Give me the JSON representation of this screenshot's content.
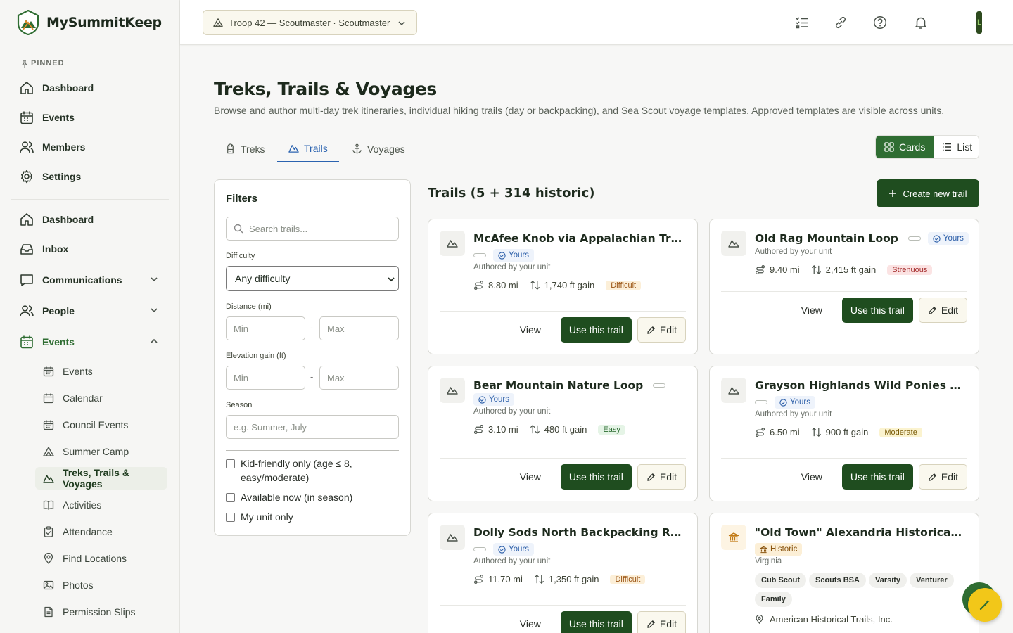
{
  "app": {
    "name": "MySummitKeep"
  },
  "sidebar": {
    "pinned_label": "PINNED",
    "pinned": [
      {
        "label": "Dashboard",
        "icon": "home-icon"
      },
      {
        "label": "Events",
        "icon": "calendar-icon"
      },
      {
        "label": "Members",
        "icon": "users-icon"
      },
      {
        "label": "Settings",
        "icon": "gear-icon"
      }
    ],
    "main": [
      {
        "label": "Dashboard",
        "icon": "home-icon"
      },
      {
        "label": "Inbox",
        "icon": "inbox-icon"
      },
      {
        "label": "Communications",
        "icon": "chat-icon",
        "expanded": false
      },
      {
        "label": "People",
        "icon": "users-icon",
        "expanded": false
      },
      {
        "label": "Events",
        "icon": "calendar-icon",
        "expanded": true
      }
    ],
    "events_sub": [
      {
        "label": "Events",
        "icon": "calendar-icon"
      },
      {
        "label": "Calendar",
        "icon": "calendar-icon"
      },
      {
        "label": "Council Events",
        "icon": "calendar-icon"
      },
      {
        "label": "Summer Camp",
        "icon": "tent-icon"
      },
      {
        "label": "Treks, Trails & Voyages",
        "icon": "mountain-icon",
        "active": true
      },
      {
        "label": "Activities",
        "icon": "book-icon"
      },
      {
        "label": "Attendance",
        "icon": "clipboard-icon"
      },
      {
        "label": "Find Locations",
        "icon": "map-pin-icon"
      },
      {
        "label": "Photos",
        "icon": "photo-icon"
      },
      {
        "label": "Permission Slips",
        "icon": "document-icon"
      }
    ]
  },
  "topbar": {
    "unit_selector": "Troop 42 — Scoutmaster · Scoutmaster",
    "avatar_initial": "L"
  },
  "page": {
    "title": "Treks, Trails & Voyages",
    "description": "Browse and author multi-day trek itineraries, individual hiking trails (day or backpacking), and Sea Scout voyage templates. Approved templates are visible across units.",
    "tabs": [
      {
        "label": "Treks",
        "icon": "backpack-icon"
      },
      {
        "label": "Trails",
        "icon": "mountain-icon",
        "active": true
      },
      {
        "label": "Voyages",
        "icon": "anchor-icon"
      }
    ],
    "view_toggle": {
      "cards": "Cards",
      "list": "List",
      "active": "Cards"
    }
  },
  "filters": {
    "title": "Filters",
    "search_placeholder": "Search trails...",
    "difficulty_label": "Difficulty",
    "difficulty_value": "Any difficulty",
    "distance_label": "Distance (mi)",
    "elevation_label": "Elevation gain (ft)",
    "min_placeholder": "Min",
    "max_placeholder": "Max",
    "range_sep": "-",
    "season_label": "Season",
    "season_placeholder": "e.g. Summer, July",
    "checkboxes": [
      {
        "label": "Kid-friendly only (age ≤ 8, easy/moderate)",
        "checked": false
      },
      {
        "label": "Available now (in season)",
        "checked": false
      },
      {
        "label": "My unit only",
        "checked": false
      }
    ]
  },
  "list": {
    "title": "Trails (5 + 314 historic)",
    "create_label": "Create new trail",
    "view_label": "View",
    "use_label": "Use this trail",
    "edit_label": "Edit",
    "cards": [
      {
        "title": "McAfee Knob via Appalachian Trail",
        "badge": "Yours",
        "author": "Authored by your unit",
        "distance": "8.80 mi",
        "gain": "1,740 ft gain",
        "difficulty": "Difficult",
        "difficulty_color": "#9a5312"
      },
      {
        "title": "Old Rag Mountain Loop",
        "badge": "Yours",
        "author": "Authored by your unit",
        "distance": "9.40 mi",
        "gain": "2,415 ft gain",
        "difficulty": "Strenuous",
        "difficulty_color": "#a32a2a"
      },
      {
        "title": "Bear Mountain Nature Loop",
        "badge": "Yours",
        "author": "Authored by your unit",
        "distance": "3.10 mi",
        "gain": "480 ft gain",
        "difficulty": "Easy",
        "difficulty_color": "#2c6b31"
      },
      {
        "title": "Grayson Highlands Wild Ponies Trek",
        "badge": "Yours",
        "author": "Authored by your unit",
        "distance": "6.50 mi",
        "gain": "900 ft gain",
        "difficulty": "Moderate",
        "difficulty_color": "#7a5b08"
      },
      {
        "title": "Dolly Sods North Backpacking Rou...",
        "badge": "Yours",
        "author": "Authored by your unit",
        "distance": "11.70 mi",
        "gain": "1,350 ft gain",
        "difficulty": "Difficult",
        "difficulty_color": "#9a5312"
      },
      {
        "title": "\"Old Town\" Alexandria Historical Tr...",
        "badge": "Historic",
        "location": "Virginia",
        "tags": [
          "Cub Scout",
          "Scouts BSA",
          "Varsity",
          "Venturer",
          "Family"
        ],
        "org": "American Historical Trails, Inc."
      }
    ]
  },
  "colors": {
    "brand": "#1f4d1f",
    "accent_blue": "#2b63b0",
    "fab": "#f2c719"
  }
}
